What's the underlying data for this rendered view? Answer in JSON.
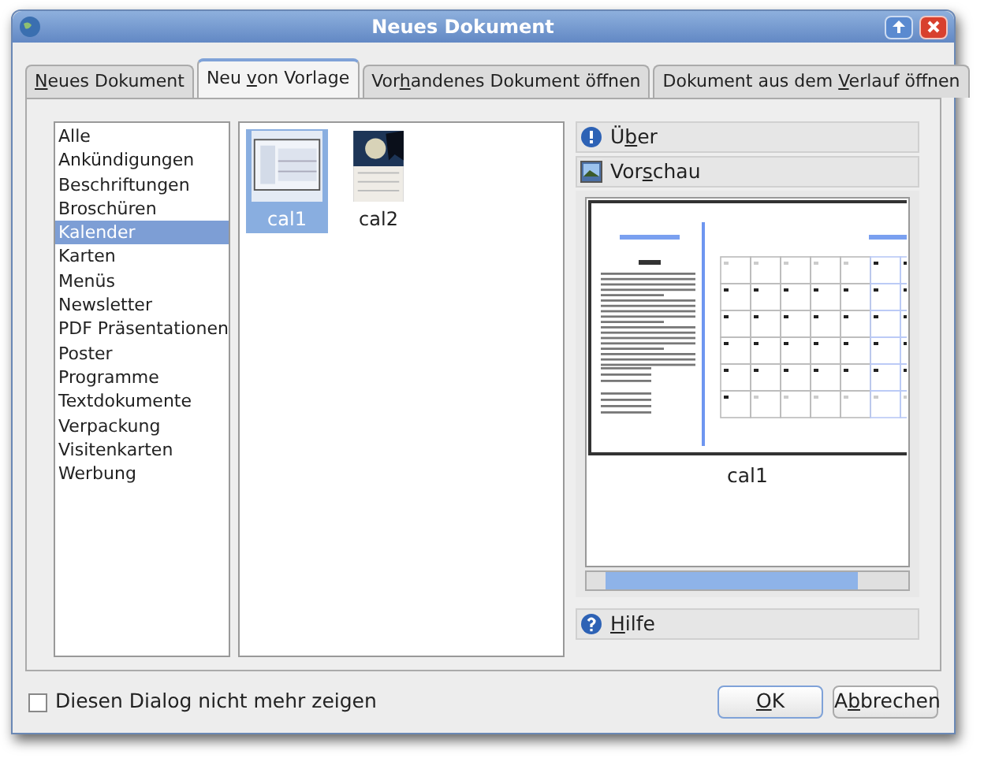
{
  "window": {
    "title": "Neues Dokument"
  },
  "tabs": [
    {
      "key": "N",
      "post": "eues Dokument",
      "selected": false
    },
    {
      "pre": "Neu ",
      "key": "v",
      "post": "on Vorlage",
      "selected": true
    },
    {
      "pre": "Vor",
      "key": "h",
      "post": "andenes Dokument öffnen",
      "selected": false
    },
    {
      "pre": "Dokument aus dem ",
      "key": "V",
      "post": "erlauf öffnen",
      "selected": false
    }
  ],
  "categories": [
    {
      "label": "Alle",
      "selected": false
    },
    {
      "label": "Ankündigungen",
      "selected": false
    },
    {
      "label": "Beschriftungen",
      "selected": false
    },
    {
      "label": "Broschüren",
      "selected": false
    },
    {
      "label": "Kalender",
      "selected": true
    },
    {
      "label": "Karten",
      "selected": false
    },
    {
      "label": "Menüs",
      "selected": false
    },
    {
      "label": "Newsletter",
      "selected": false
    },
    {
      "label": "PDF Präsentationen",
      "selected": false
    },
    {
      "label": "Poster",
      "selected": false
    },
    {
      "label": "Programme",
      "selected": false
    },
    {
      "label": "Textdokumente",
      "selected": false
    },
    {
      "label": "Verpackung",
      "selected": false
    },
    {
      "label": "Visitenkarten",
      "selected": false
    },
    {
      "label": "Werbung",
      "selected": false
    }
  ],
  "templates": [
    {
      "label": "cal1",
      "selected": true,
      "kind": "picture"
    },
    {
      "label": "cal2",
      "selected": false,
      "kind": "picture"
    }
  ],
  "sections": [
    {
      "pre": "Ü",
      "key": "b",
      "post": "er",
      "kind": "info"
    },
    {
      "pre": "Vor",
      "key": "s",
      "post": "chau",
      "kind": "preview"
    }
  ],
  "preview": {
    "caption": "cal1"
  },
  "help": {
    "key": "H",
    "post": "ilfe"
  },
  "dont_show": {
    "label": "Diesen Dialog nicht mehr zeigen",
    "checked": false
  },
  "buttons": [
    {
      "key": "O",
      "post": "K",
      "kind": "default"
    },
    {
      "pre": "A",
      "key": "b",
      "post": "brechen",
      "kind": "normal"
    }
  ]
}
